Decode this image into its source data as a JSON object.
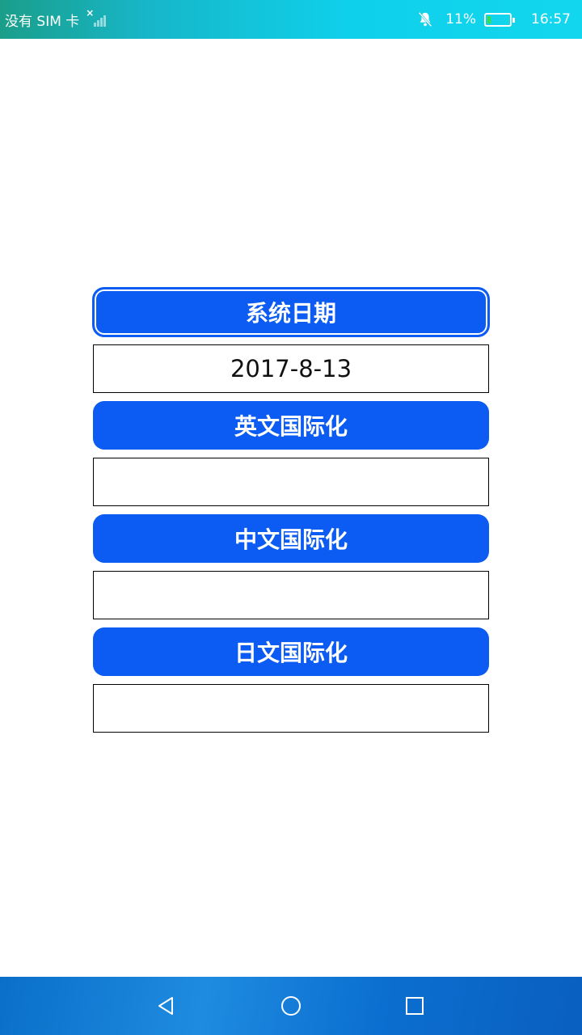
{
  "status_bar": {
    "carrier": "没有 SIM 卡",
    "battery_percent": "11%",
    "time": "16:57"
  },
  "main": {
    "buttons": [
      {
        "label": "系统日期"
      },
      {
        "label": "英文国际化"
      },
      {
        "label": "中文国际化"
      },
      {
        "label": "日文国际化"
      }
    ],
    "fields": [
      {
        "value": "2017-8-13"
      },
      {
        "value": ""
      },
      {
        "value": ""
      },
      {
        "value": ""
      }
    ]
  },
  "colors": {
    "accent": "#0c5cf3",
    "battery_fill": "#39e03a"
  },
  "icons": {
    "signal": "no-signal-icon",
    "notifications": "bell-off-icon",
    "battery": "battery-icon",
    "back": "back-triangle-icon",
    "home": "home-circle-icon",
    "recents": "recents-square-icon"
  }
}
